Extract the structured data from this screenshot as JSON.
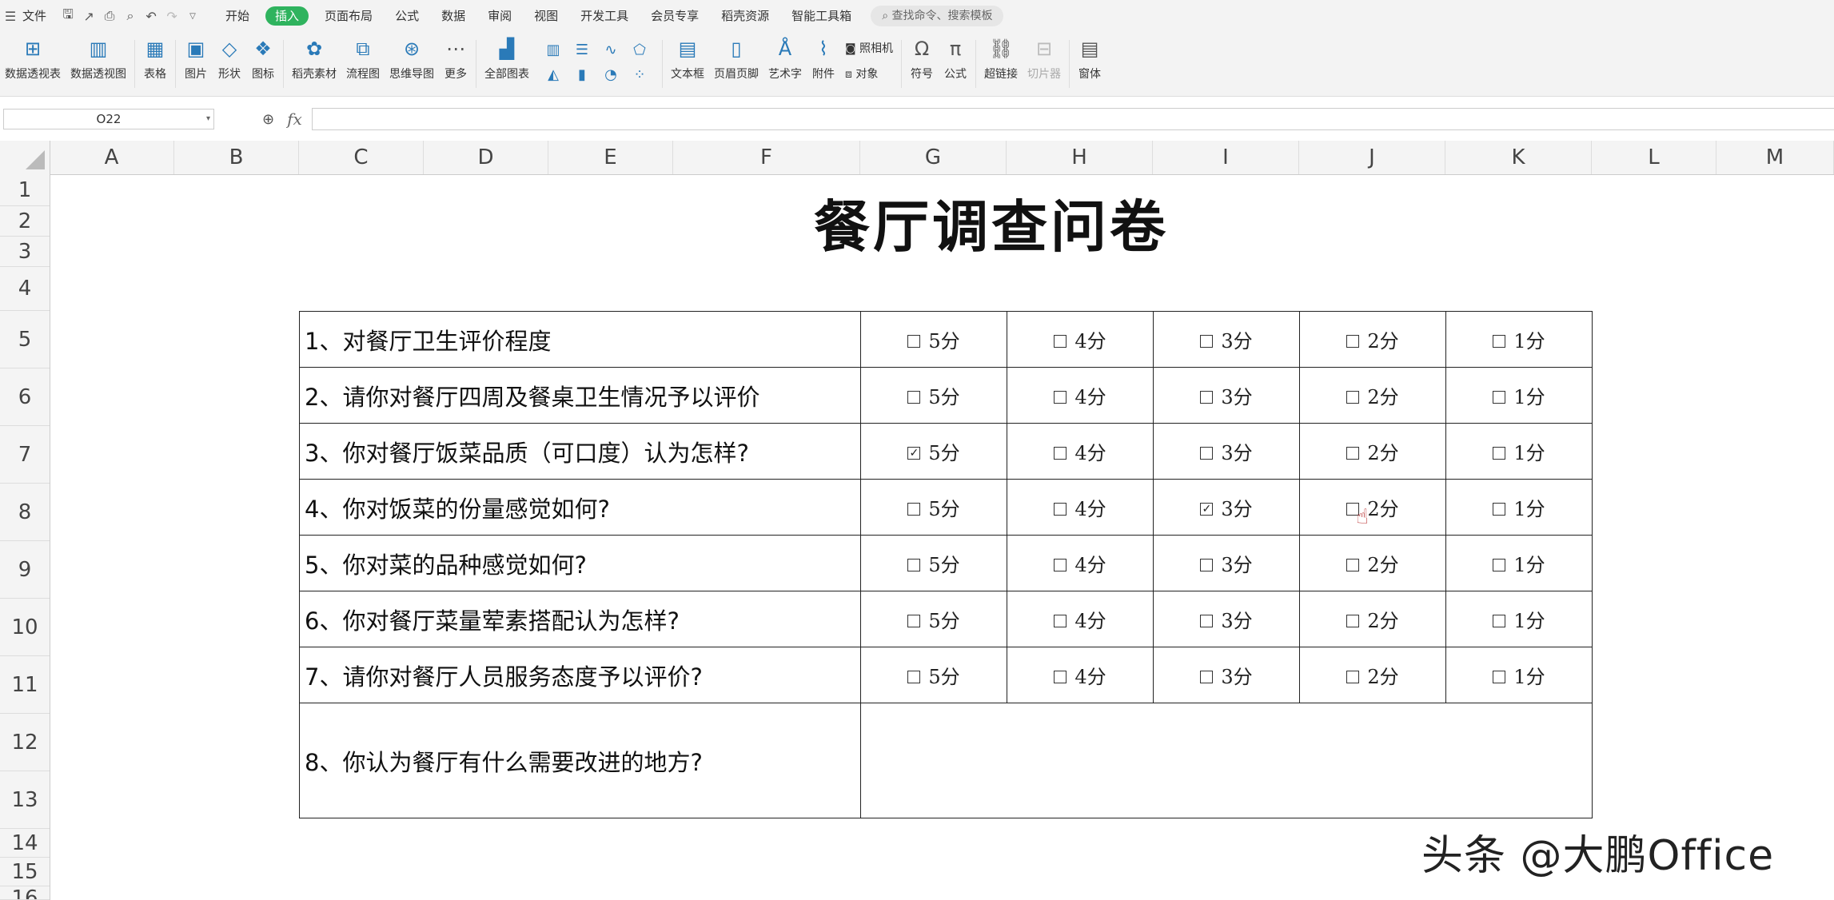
{
  "menubar": {
    "file": "文件",
    "tabs": [
      "开始",
      "插入",
      "页面布局",
      "公式",
      "数据",
      "审阅",
      "视图",
      "开发工具",
      "会员专享",
      "稻壳资源",
      "智能工具箱"
    ],
    "active_tab": "插入",
    "search_placeholder": "查找命令、搜索模板"
  },
  "ribbon": {
    "pivot_table": "数据透视表",
    "pivot_chart": "数据透视图",
    "table": "表格",
    "picture": "图片",
    "shape": "形状",
    "icon": "图标",
    "daoke": "稻壳素材",
    "flowchart": "流程图",
    "mindmap": "思维导图",
    "more": "更多",
    "all_charts": "全部图表",
    "textbox": "文本框",
    "header_footer": "页眉页脚",
    "wordart": "艺术字",
    "attachment": "附件",
    "camera": "照相机",
    "object": "对象",
    "symbol": "符号",
    "formula": "公式",
    "hyperlink": "超链接",
    "slicer": "切片器",
    "window": "窗体"
  },
  "formula_bar": {
    "name_box": "O22",
    "fx": "fx",
    "formula": ""
  },
  "columns": [
    "A",
    "B",
    "C",
    "D",
    "E",
    "F",
    "G",
    "H",
    "I",
    "J",
    "K",
    "L",
    "M"
  ],
  "rows": [
    "1",
    "2",
    "3",
    "4",
    "5",
    "6",
    "7",
    "8",
    "9",
    "10",
    "11",
    "12",
    "13",
    "14",
    "15",
    "16"
  ],
  "sheet": {
    "title": "餐厅调查问卷",
    "questions": [
      {
        "text": "1、对餐厅卫生评价程度",
        "options": [
          "5分",
          "4分",
          "3分",
          "2分",
          "1分"
        ],
        "checked": [
          false,
          false,
          false,
          false,
          false
        ]
      },
      {
        "text": "2、请你对餐厅四周及餐桌卫生情况予以评价",
        "options": [
          "5分",
          "4分",
          "3分",
          "2分",
          "1分"
        ],
        "checked": [
          false,
          false,
          false,
          false,
          false
        ]
      },
      {
        "text": "3、你对餐厅饭菜品质（可口度）认为怎样?",
        "options": [
          "5分",
          "4分",
          "3分",
          "2分",
          "1分"
        ],
        "checked": [
          true,
          false,
          false,
          false,
          false
        ]
      },
      {
        "text": "4、你对饭菜的份量感觉如何?",
        "options": [
          "5分",
          "4分",
          "3分",
          "2分",
          "1分"
        ],
        "checked": [
          false,
          false,
          true,
          false,
          false
        ]
      },
      {
        "text": "5、你对菜的品种感觉如何?",
        "options": [
          "5分",
          "4分",
          "3分",
          "2分",
          "1分"
        ],
        "checked": [
          false,
          false,
          false,
          false,
          false
        ]
      },
      {
        "text": "6、你对餐厅菜量荤素搭配认为怎样?",
        "options": [
          "5分",
          "4分",
          "3分",
          "2分",
          "1分"
        ],
        "checked": [
          false,
          false,
          false,
          false,
          false
        ]
      },
      {
        "text": "7、请你对餐厅人员服务态度予以评价?",
        "options": [
          "5分",
          "4分",
          "3分",
          "2分",
          "1分"
        ],
        "checked": [
          false,
          false,
          false,
          false,
          false
        ]
      }
    ],
    "last_question": "8、你认为餐厅有什么需要改进的地方?"
  },
  "watermark": "头条 @大鹏Office"
}
